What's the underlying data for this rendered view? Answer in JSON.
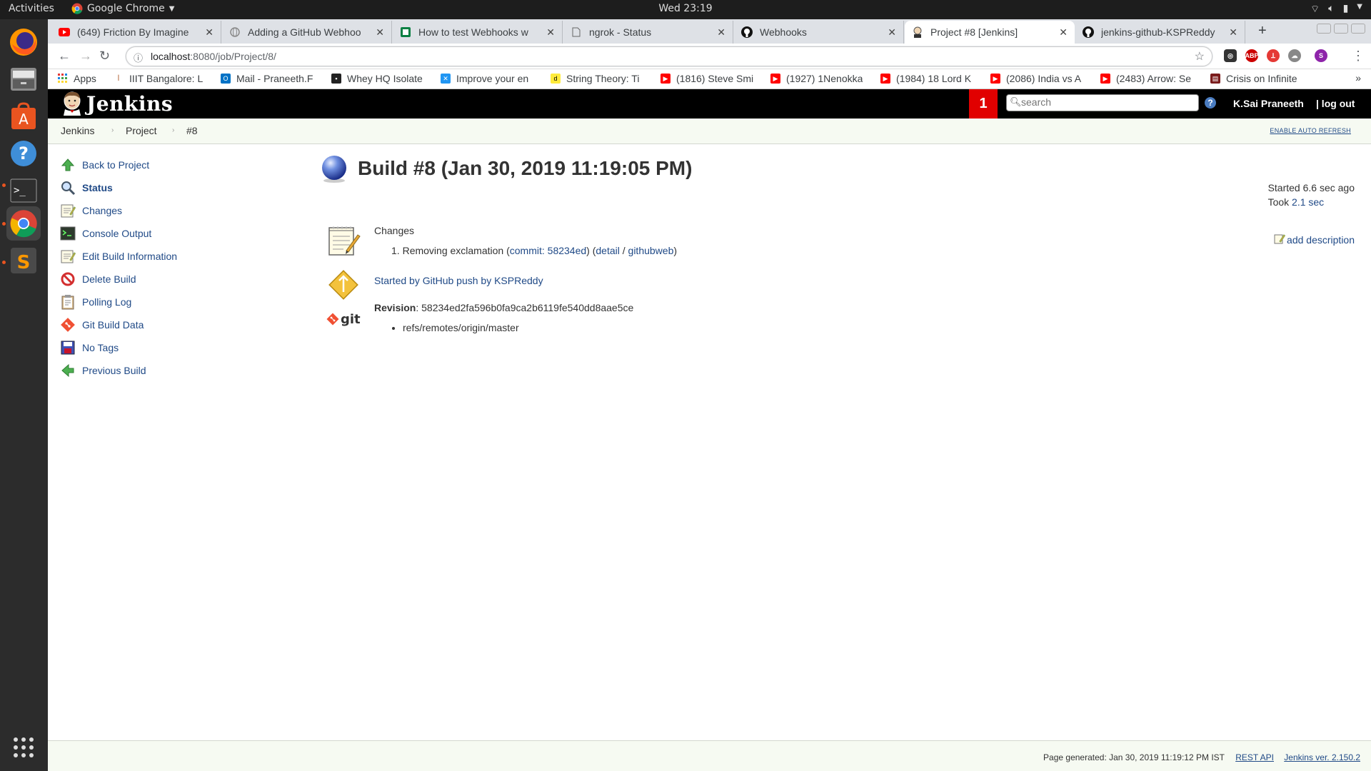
{
  "os": {
    "activities": "Activities",
    "app_name": "Google Chrome",
    "clock": "Wed 23:19"
  },
  "browser": {
    "tabs": [
      {
        "label": "(649) Friction By Imagine",
        "icon": "youtube-icon"
      },
      {
        "label": "Adding a GitHub Webhoo",
        "icon": "globe-icon"
      },
      {
        "label": "How to test Webhooks w",
        "icon": "sheet-icon"
      },
      {
        "label": "ngrok - Status",
        "icon": "page-icon"
      },
      {
        "label": "Webhooks",
        "icon": "github-icon"
      },
      {
        "label": "Project #8 [Jenkins]",
        "icon": "jenkins-icon"
      },
      {
        "label": "jenkins-github-KSPReddy",
        "icon": "github-icon"
      }
    ],
    "url_host": "localhost",
    "url_path": ":8080/job/Project/8/",
    "profile_initial": "S",
    "bookmarks": [
      {
        "label": "Apps"
      },
      {
        "label": "IIIT Bangalore: L"
      },
      {
        "label": "Mail - Praneeth.F"
      },
      {
        "label": "Whey HQ Isolate"
      },
      {
        "label": "Improve your en"
      },
      {
        "label": "String Theory: Ti"
      },
      {
        "label": "(1816) Steve Smi"
      },
      {
        "label": "(1927) 1Nenokka"
      },
      {
        "label": "(1984) 18 Lord K"
      },
      {
        "label": "(2086) India vs A"
      },
      {
        "label": "(2483) Arrow: Se"
      },
      {
        "label": "Crisis on Infinite"
      }
    ]
  },
  "jenkins": {
    "logo_text": "Jenkins",
    "notification_count": "1",
    "search_placeholder": "search",
    "user": "K.Sai Praneeth",
    "logout": "| log out",
    "breadcrumbs": [
      "Jenkins",
      "Project",
      "#8"
    ],
    "auto_refresh": "ENABLE AUTO REFRESH",
    "tasks": [
      {
        "label": "Back to Project",
        "icon": "up-arrow-icon"
      },
      {
        "label": "Status",
        "icon": "magnifier-icon"
      },
      {
        "label": "Changes",
        "icon": "notepad-icon"
      },
      {
        "label": "Console Output",
        "icon": "terminal-icon"
      },
      {
        "label": "Edit Build Information",
        "icon": "notepad-icon"
      },
      {
        "label": "Delete Build",
        "icon": "no-entry-icon"
      },
      {
        "label": "Polling Log",
        "icon": "clipboard-icon"
      },
      {
        "label": "Git Build Data",
        "icon": "git-icon"
      },
      {
        "label": "No Tags",
        "icon": "save-icon"
      },
      {
        "label": "Previous Build",
        "icon": "left-arrow-icon"
      }
    ],
    "build_title": "Build #8 (Jan 30, 2019 11:19:05 PM)",
    "started": "Started 6.6 sec ago",
    "took_prefix": "Took",
    "took_value": "2.1 sec",
    "add_description": "add description",
    "changes_heading": "Changes",
    "change_number": "1.",
    "change_message": "Removing exclamation",
    "change_commit": "commit: 58234ed",
    "change_detail": "detail",
    "change_githubweb": "githubweb",
    "cause": "Started by GitHub push by KSPReddy",
    "revision_label": "Revision",
    "revision_value": ": 58234ed2fa596b0fa9ca2b6119fe540dd8aae5ce",
    "branch": "refs/remotes/origin/master",
    "git_label": "git",
    "footer_generated": "Page generated: Jan 30, 2019 11:19:12 PM IST",
    "footer_rest": "REST API",
    "footer_version": "Jenkins ver. 2.150.2"
  },
  "colors": {
    "jenkins_header": "#000000",
    "badge_red": "#e10000",
    "link_blue": "#204a87",
    "dock_bg": "#2c2c2c"
  }
}
